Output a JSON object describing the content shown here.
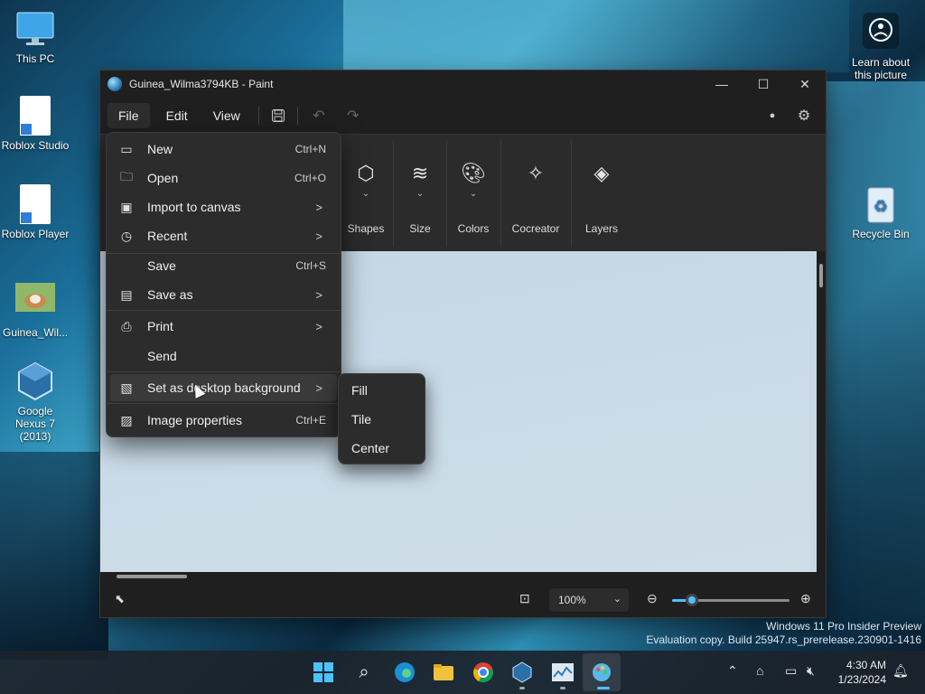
{
  "desktop": {
    "icons": [
      {
        "label": "This PC"
      },
      {
        "label": "Roblox Studio"
      },
      {
        "label": "Roblox Player"
      },
      {
        "label": "Guinea_Wil..."
      },
      {
        "label": "Google Nexus 7 (2013)"
      },
      {
        "label": "Recycle Bin"
      }
    ],
    "learn_about": "Learn about this picture",
    "watermark_line1": "Windows 11 Pro Insider Preview",
    "watermark_line2": "Evaluation copy. Build 25947.rs_prerelease.230901-1416"
  },
  "window": {
    "title": "Guinea_Wilma3794KB - Paint",
    "menu": [
      "File",
      "Edit",
      "View"
    ],
    "ribbon": {
      "shapes": "Shapes",
      "size": "Size",
      "colors": "Colors",
      "cocreator": "Cocreator",
      "layers": "Layers"
    },
    "zoom": "100%",
    "zoom_level": 0.17
  },
  "file_menu": {
    "items": [
      {
        "label": "New",
        "shortcut": "Ctrl+N"
      },
      {
        "label": "Open",
        "shortcut": "Ctrl+O"
      },
      {
        "label": "Import to canvas",
        "shortcut": ">"
      },
      {
        "label": "Recent",
        "shortcut": ">"
      },
      {
        "label": "Save",
        "shortcut": "Ctrl+S"
      },
      {
        "label": "Save as",
        "shortcut": ">"
      },
      {
        "label": "Print",
        "shortcut": ">"
      },
      {
        "label": "Send",
        "shortcut": ""
      },
      {
        "label": "Set as desktop background",
        "shortcut": ">"
      },
      {
        "label": "Image properties",
        "shortcut": "Ctrl+E"
      }
    ],
    "submenu": [
      "Fill",
      "Tile",
      "Center"
    ]
  },
  "taskbar": {
    "time": "4:30 AM",
    "date": "1/23/2024"
  },
  "colors": {
    "accent": "#4cc2ff",
    "menu_bg": "#2c2c2c",
    "window_bg": "#1f1f1f"
  }
}
